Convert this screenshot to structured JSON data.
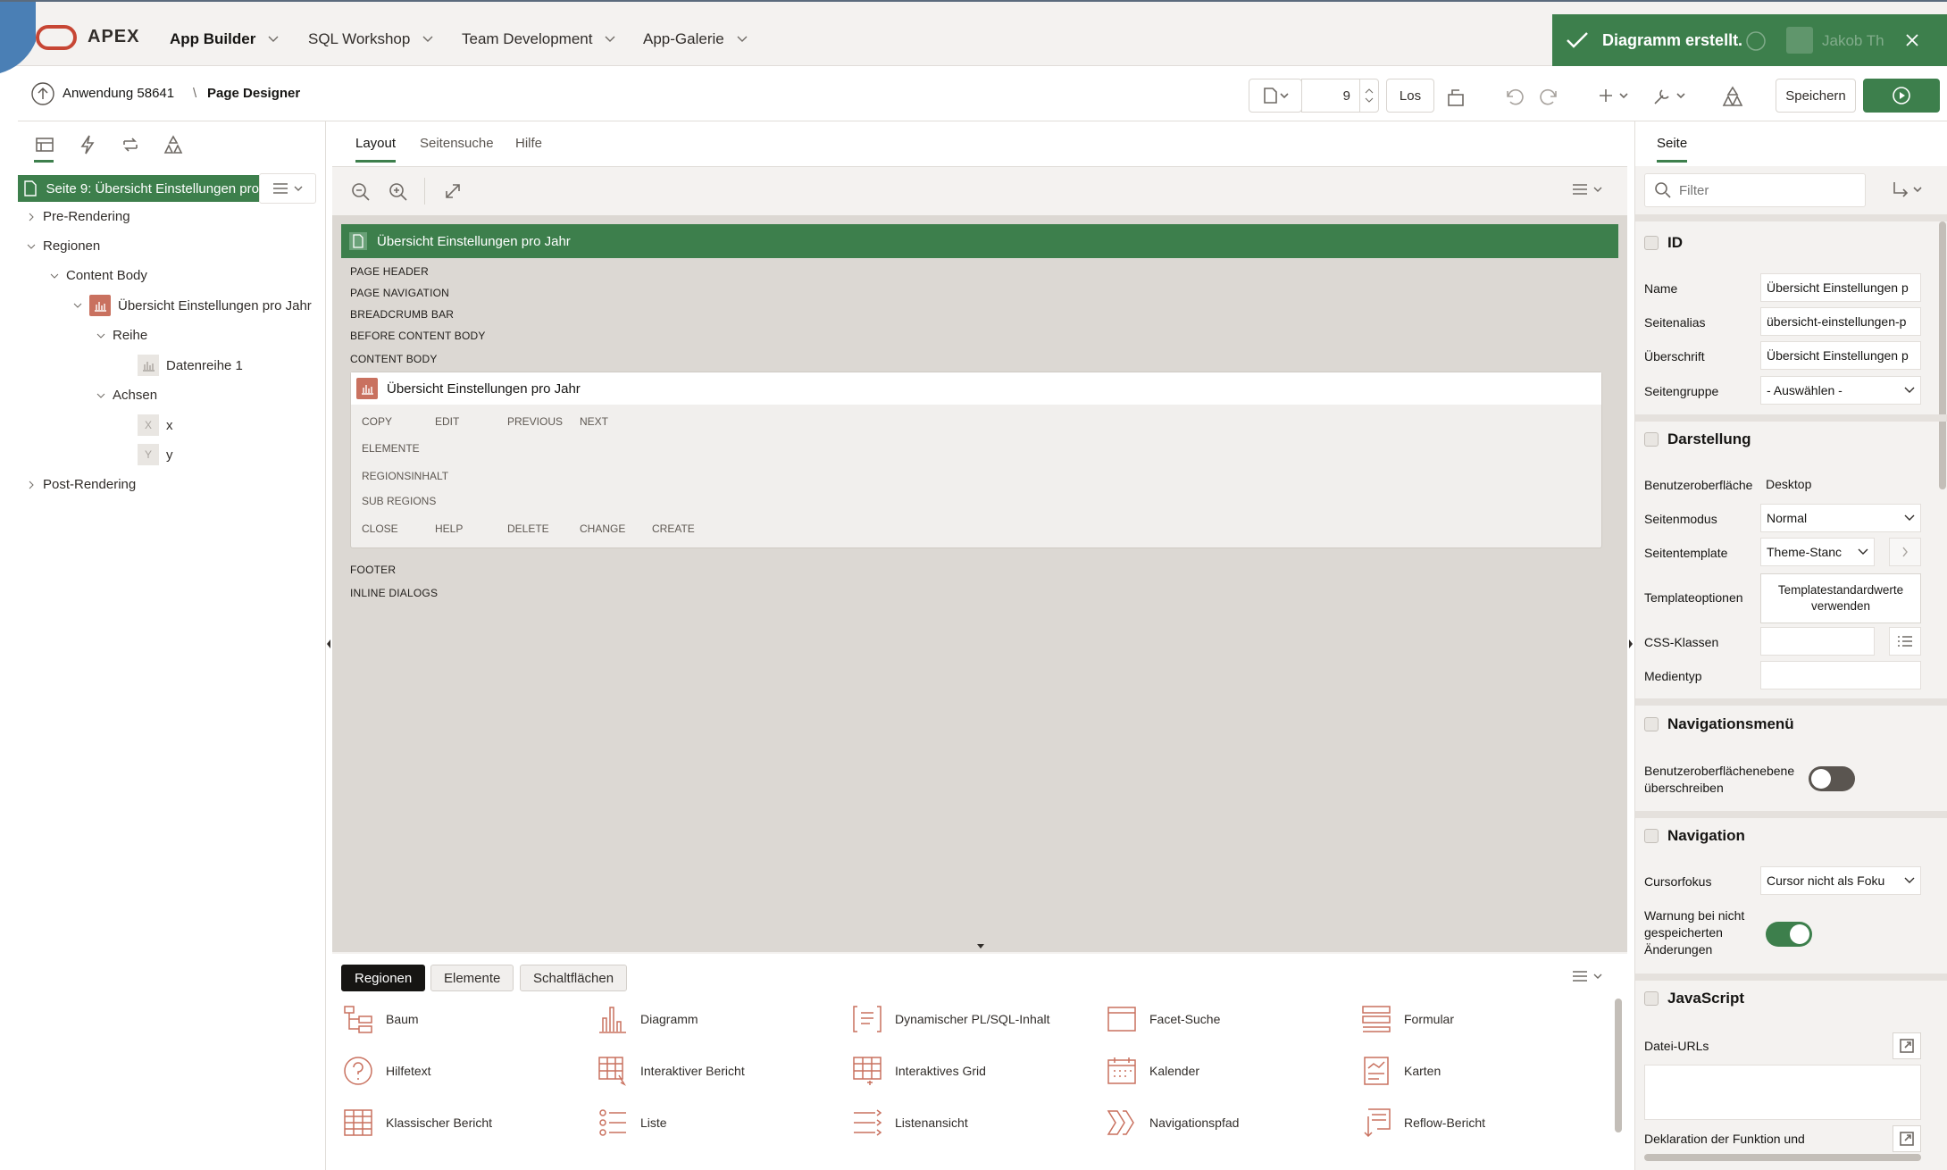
{
  "topbar": {
    "logo": "APEX",
    "nav": [
      {
        "label": "App Builder"
      },
      {
        "label": "SQL Workshop"
      },
      {
        "label": "Team Development"
      },
      {
        "label": "App-Galerie"
      }
    ],
    "user": "Jakob Th"
  },
  "toast": {
    "message": "Diagramm erstellt."
  },
  "breadcrumb": {
    "app": "Anwendung 58641",
    "page": "Page Designer"
  },
  "toolbar": {
    "page_number": "9",
    "go_label": "Los",
    "save_label": "Speichern"
  },
  "left": {
    "page_node": "Seite 9: Übersicht Einstellungen pro",
    "tree": [
      {
        "label": "Pre-Rendering"
      },
      {
        "label": "Regionen"
      },
      {
        "label": "Content Body"
      },
      {
        "label": "Übersicht Einstellungen pro Jahr"
      },
      {
        "label": "Reihe"
      },
      {
        "label": "Datenreihe 1"
      },
      {
        "label": "Achsen"
      },
      {
        "label": "x"
      },
      {
        "label": "y"
      },
      {
        "label": "Post-Rendering"
      }
    ]
  },
  "mid": {
    "tabs": [
      {
        "label": "Layout"
      },
      {
        "label": "Seitensuche"
      },
      {
        "label": "Hilfe"
      }
    ],
    "page_title": "Übersicht Einstellungen pro Jahr",
    "positions": [
      "PAGE HEADER",
      "PAGE NAVIGATION",
      "BREADCRUMB BAR",
      "BEFORE CONTENT BODY",
      "CONTENT BODY"
    ],
    "region_title": "Übersicht Einstellungen pro Jahr",
    "region_row1": [
      "COPY",
      "EDIT",
      "PREVIOUS",
      "NEXT"
    ],
    "region_elements": "ELEMENTE",
    "region_content": "REGIONSINHALT",
    "region_sub": "SUB REGIONS",
    "region_row2": [
      "CLOSE",
      "HELP",
      "DELETE",
      "CHANGE",
      "CREATE"
    ],
    "positions_after": [
      "FOOTER",
      "INLINE DIALOGS"
    ]
  },
  "gallery": {
    "tabs": [
      {
        "label": "Regionen"
      },
      {
        "label": "Elemente"
      },
      {
        "label": "Schaltflächen"
      }
    ],
    "items": [
      {
        "label": "Baum",
        "icon": "tree-icon"
      },
      {
        "label": "Diagramm",
        "icon": "chart-icon"
      },
      {
        "label": "Dynamischer PL/SQL-Inhalt",
        "icon": "plsql-icon"
      },
      {
        "label": "Facet-Suche",
        "icon": "facet-icon"
      },
      {
        "label": "Formular",
        "icon": "form-icon"
      },
      {
        "label": "Hilfetext",
        "icon": "help-icon"
      },
      {
        "label": "Interaktiver Bericht",
        "icon": "interactive-report-icon"
      },
      {
        "label": "Interaktives Grid",
        "icon": "grid-icon"
      },
      {
        "label": "Kalender",
        "icon": "calendar-icon"
      },
      {
        "label": "Karten",
        "icon": "cards-icon"
      },
      {
        "label": "Klassischer Bericht",
        "icon": "classic-report-icon"
      },
      {
        "label": "Liste",
        "icon": "list-icon"
      },
      {
        "label": "Listenansicht",
        "icon": "listview-icon"
      },
      {
        "label": "Navigationspfad",
        "icon": "breadcrumb-icon"
      },
      {
        "label": "Reflow-Bericht",
        "icon": "reflow-icon"
      }
    ]
  },
  "right": {
    "tab": "Seite",
    "filter_placeholder": "Filter",
    "sections": {
      "id": "ID",
      "darstellung": "Darstellung",
      "navmenu": "Navigationsmenü",
      "navigation": "Navigation",
      "javascript": "JavaScript"
    },
    "props": {
      "name_label": "Name",
      "name_value": "Übersicht Einstellungen p",
      "alias_label": "Seitenalias",
      "alias_value": "übersicht-einstellungen-p",
      "heading_label": "Überschrift",
      "heading_value": "Übersicht Einstellungen p",
      "group_label": "Seitengruppe",
      "group_value": "- Auswählen -",
      "ui_label": "Benutzeroberfläche",
      "ui_value": "Desktop",
      "mode_label": "Seitenmodus",
      "mode_value": "Normal",
      "template_label": "Seitentemplate",
      "template_value": "Theme-Stanc",
      "tplopt_label": "Templateoptionen",
      "tplopt_value": "Templatestandardwerte verwenden",
      "css_label": "CSS-Klassen",
      "media_label": "Medientyp",
      "override_label": "Benutzeroberflächenebene überschreiben",
      "cursor_label": "Cursorfokus",
      "cursor_value": "Cursor nicht als Foku",
      "warn_label": "Warnung bei nicht gespeicherten Änderungen",
      "fileurls_label": "Datei-URLs",
      "decl_label": "Deklaration der Funktion und"
    },
    "override_on": false,
    "warn_on": true
  },
  "colors": {
    "accent": "#3d7f4c",
    "oracle_red": "#c74634",
    "region_icon": "#c9715f"
  }
}
